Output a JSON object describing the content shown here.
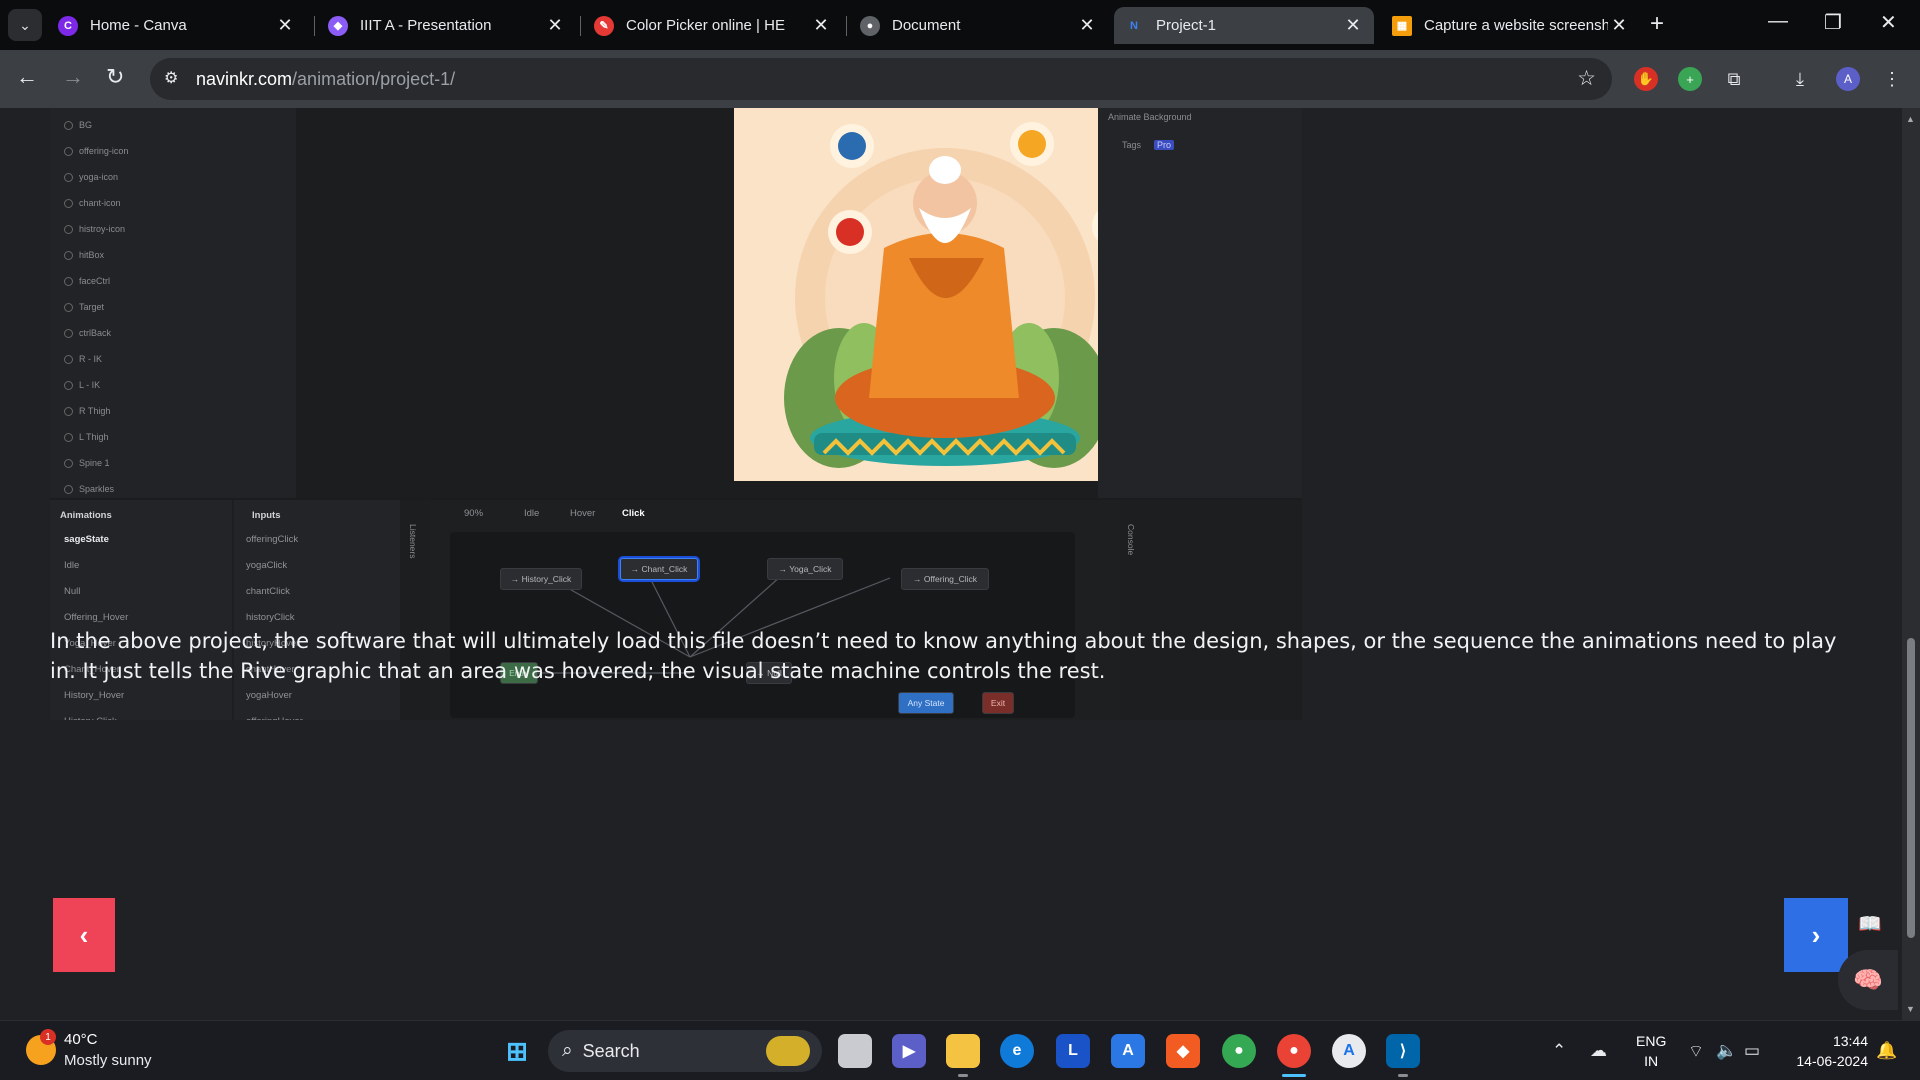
{
  "browser": {
    "tabs": [
      {
        "title": "Home - Canva",
        "icon": "canva-icon",
        "color": "#7d2ae8",
        "active": false
      },
      {
        "title": "IIIT A - Presentation",
        "icon": "presentation-icon",
        "color": "#8b5cf6",
        "active": false
      },
      {
        "title": "Color Picker online | HE",
        "icon": "color-picker-icon",
        "color": "#e53935",
        "active": false
      },
      {
        "title": "Document",
        "icon": "document-icon",
        "color": "#5f6368",
        "active": false
      },
      {
        "title": "Project-1",
        "icon": "site-logo-icon",
        "color": "#3b82f6",
        "active": true
      },
      {
        "title": "Capture a website screensh",
        "icon": "screenshot-app-icon",
        "color": "#f59e0b",
        "active": false
      }
    ],
    "tab_close_glyph": "✕",
    "url_host": "navinkr.com",
    "url_path": "/animation/project-1/"
  },
  "rive_editor": {
    "layers": [
      "BG",
      "offering-icon",
      "yoga-icon",
      "chant-icon",
      "histroy-icon",
      "hitBox",
      "faceCtrl",
      "Target",
      "ctrlBack",
      "R - IK",
      "L - IK",
      "R Thigh",
      "L Thigh",
      "Spine 1",
      "Sparkles"
    ],
    "right_panel": [
      "Animate Background",
      "Tags",
      "Pro"
    ],
    "animations_header": "Animations",
    "animations": [
      "sageState",
      "Idle",
      "Null",
      "Offering_Hover",
      "Yoga_Hover",
      "Chant_Hover",
      "History_Hover",
      "History Click"
    ],
    "inputs_header": "Inputs",
    "inputs": [
      "offeringClick",
      "yogaClick",
      "chantClick",
      "historyClick",
      "historyHover",
      "chantHover",
      "yogaHover",
      "offeringHover"
    ],
    "listeners_label": "Listeners",
    "console_label": "Console",
    "zoom": "90%",
    "sm_tabs": [
      "Idle",
      "Hover",
      "Click"
    ],
    "active_sm_tab": "Click",
    "nodes": {
      "history": "→ History_Click",
      "chant": "→ Chant_Click",
      "yoga": "→ Yoga_Click",
      "offering": "→ Offering_Click",
      "entry": "Entry",
      "null": "→ Null",
      "any": "Any State",
      "exit": "Exit"
    }
  },
  "article": {
    "text": "In the above project, the software that will ultimately load this file doesn’t need to know anything about the design, shapes, or the sequence the animations need to play in. It just tells the Rive graphic that an area was hovered; the visual state machine controls the rest."
  },
  "pagination": {
    "prev_glyph": "‹",
    "next_glyph": "›"
  },
  "taskbar": {
    "weather_temp": "40°C",
    "weather_condition": "Mostly sunny",
    "weather_badge": "1",
    "search_label": "Search",
    "lang_top": "ENG",
    "lang_bottom": "IN",
    "time": "13:44",
    "date": "14-06-2024",
    "apps": [
      "start-icon",
      "task-view-icon",
      "meet-icon",
      "file-explorer-icon",
      "edge-icon",
      "l-app-icon",
      "vscode-like-icon",
      "brave-icon",
      "chrome-icon",
      "chrome-profile-icon",
      "app-store-icon",
      "vscode-icon"
    ]
  },
  "colors": {
    "prev_button": "#ef4458",
    "next_button": "#2f6fe6",
    "page_bg": "#1f2125"
  }
}
